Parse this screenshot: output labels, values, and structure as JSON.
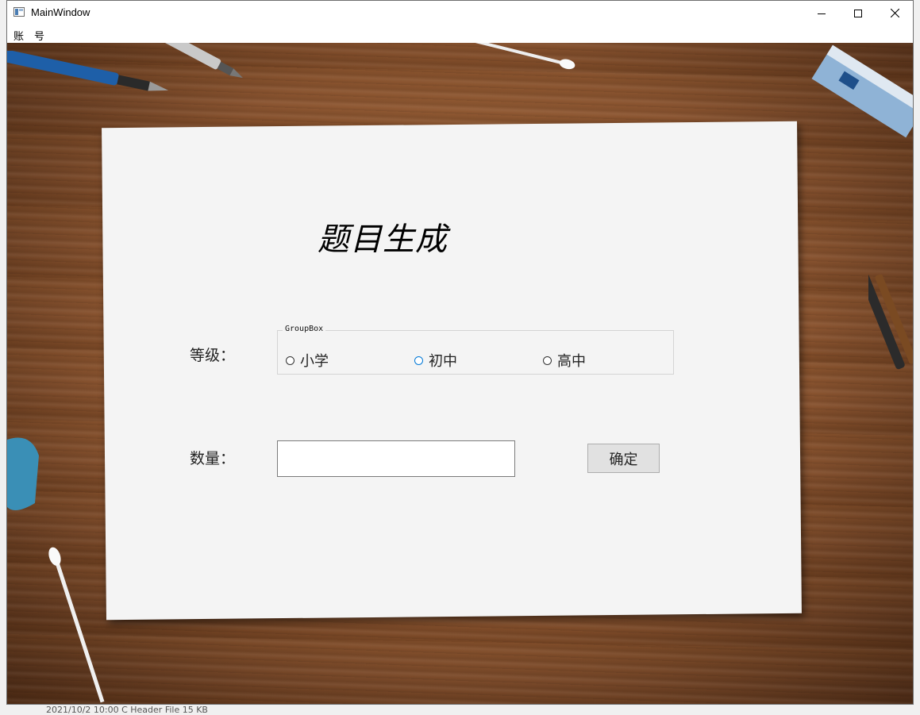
{
  "window": {
    "title": "MainWindow"
  },
  "menu": {
    "items": [
      "账号"
    ]
  },
  "form": {
    "heading": "题目生成",
    "level_label": "等级：",
    "groupbox_title": "GroupBox",
    "radio_options": [
      "小学",
      "初中",
      "高中"
    ],
    "focused_option": "初中",
    "quantity_label": "数量：",
    "quantity_value": "",
    "confirm_label": "确定"
  },
  "background_desktop_text": "2021/10/2 10:00        C Header File            15 KB",
  "colors": {
    "focus_accent": "#0078d7",
    "paper": "#f4f4f4",
    "button_face": "#e1e1e1"
  }
}
